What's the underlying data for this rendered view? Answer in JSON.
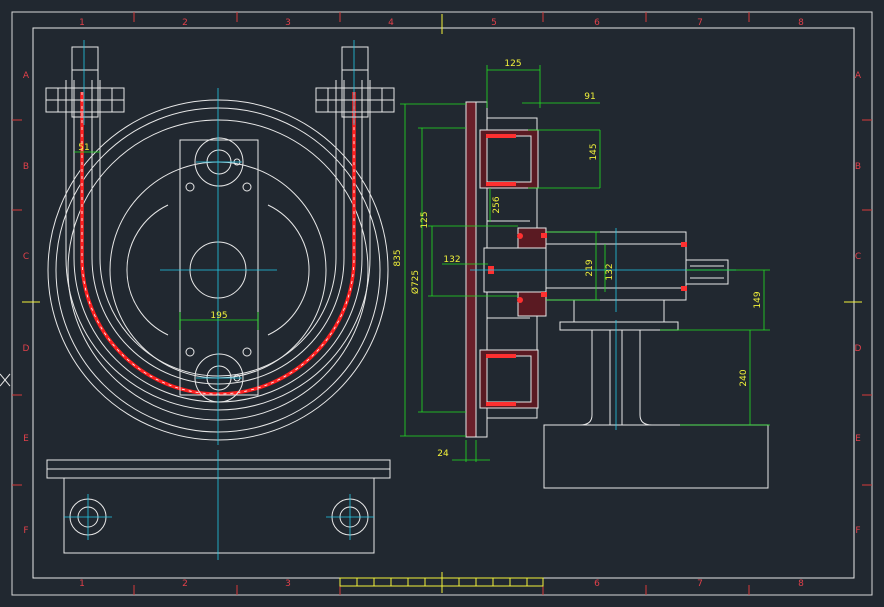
{
  "colors": {
    "background": "#212830",
    "frame": "#d63a3a",
    "outline": "#e8e8e8",
    "dimension": "#22e022",
    "dimension_text": "#f2f23a",
    "centerline": "#22c8e8",
    "belt": "#ff2020"
  },
  "frame": {
    "columns": [
      "1",
      "2",
      "3",
      "4",
      "5",
      "6",
      "7",
      "8"
    ],
    "rows": [
      "A",
      "B",
      "C",
      "D",
      "E",
      "F"
    ]
  },
  "dimensions": {
    "d125_top": "125",
    "d91": "91",
    "d145": "145",
    "d51": "51",
    "d256": "256",
    "d125_side": "125",
    "d835": "835",
    "d725": "Ø725",
    "d132_left": "132",
    "d219": "219",
    "d132_right": "132",
    "d195": "195",
    "d149": "149",
    "d240": "240",
    "d24": "24"
  }
}
